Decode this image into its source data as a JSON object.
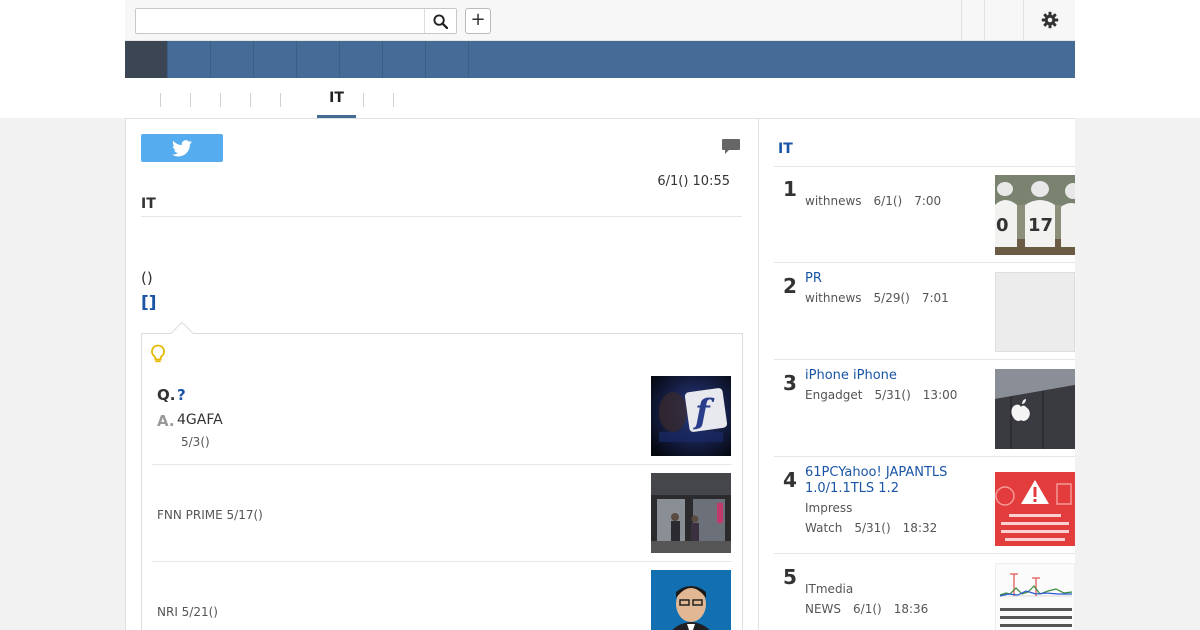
{
  "search": {
    "placeholder": "",
    "value": ""
  },
  "topbar": {
    "add_label": "+"
  },
  "subnav": {
    "active_tab": "IT"
  },
  "article": {
    "datetime": "6/1() 10:55",
    "category": "IT",
    "paren_text": "()",
    "bracket_link": "[]"
  },
  "qa": {
    "q_label": "Q.",
    "q_text": "?",
    "a_label": "A.",
    "a_text": "4GAFA",
    "a_date": "5/3()",
    "items": [
      {
        "source": "FNN PRIME 5/17()"
      },
      {
        "source": "NRI 5/21()"
      }
    ]
  },
  "sidebar": {
    "title": "IT",
    "ranking": [
      {
        "rank": "1",
        "title": "",
        "source": "withnews",
        "date": "6/1()",
        "time": "7:00"
      },
      {
        "rank": "2",
        "title": "PR",
        "source": "withnews",
        "date": "5/29()",
        "time": "7:01"
      },
      {
        "rank": "3",
        "title": "iPhone iPhone",
        "source": "Engadget",
        "date": "5/31()",
        "time": "13:00"
      },
      {
        "rank": "4",
        "title": "61PCYahoo! JAPANTLS 1.0/1.1TLS 1.2",
        "source": "Impress Watch",
        "date": "5/31()",
        "time": "18:32"
      },
      {
        "rank": "5",
        "title": "",
        "source": "ITmedia NEWS",
        "date": "6/1()",
        "time": "18:36"
      }
    ]
  },
  "colors": {
    "nav_blue": "#456c97",
    "nav_active": "#3c4554",
    "link_blue": "#1a55a5",
    "twitter": "#55acee"
  }
}
